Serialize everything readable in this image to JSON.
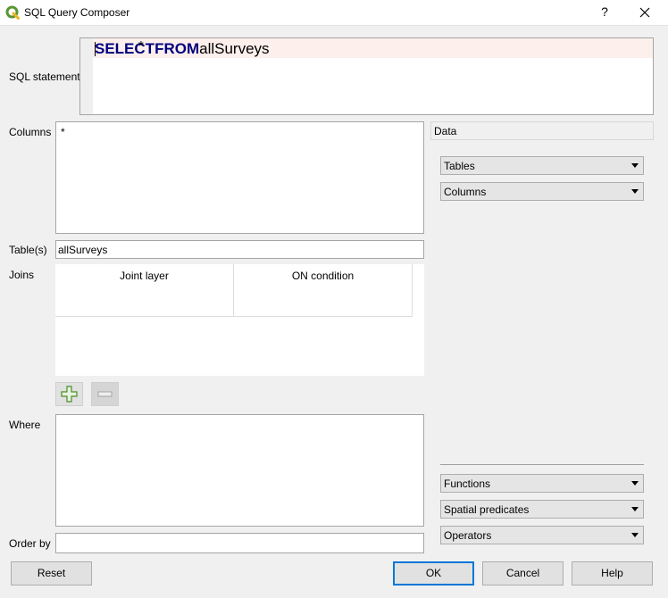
{
  "window": {
    "title": "SQL Query Composer",
    "help_label": "?"
  },
  "sql": {
    "label": "SQL statement",
    "keyword_select": "SELECT",
    "star": "*",
    "keyword_from": "FROM",
    "table": "allSurveys"
  },
  "columns": {
    "label": "Columns",
    "value": "*"
  },
  "tables": {
    "label": "Table(s)",
    "value": "allSurveys"
  },
  "joins": {
    "label": "Joins",
    "headers": [
      "Joint layer",
      "ON condition"
    ]
  },
  "where": {
    "label": "Where",
    "value": ""
  },
  "order_by": {
    "label": "Order by",
    "value": ""
  },
  "data_panel": {
    "header": "Data",
    "combos": [
      "Tables",
      "Columns",
      "Functions",
      "Spatial predicates",
      "Operators"
    ]
  },
  "buttons": {
    "reset": "Reset",
    "ok": "OK",
    "cancel": "Cancel",
    "help": "Help"
  },
  "icons": {
    "app": "qgis-logo-icon",
    "close": "close-icon",
    "add": "plus-icon",
    "remove": "minus-icon",
    "dropdown": "chevron-down-icon"
  },
  "colors": {
    "keyword": "#00007f",
    "current_line": "#fcefec",
    "ok_focus": "#0078d7",
    "qgis_green": "#589632"
  }
}
